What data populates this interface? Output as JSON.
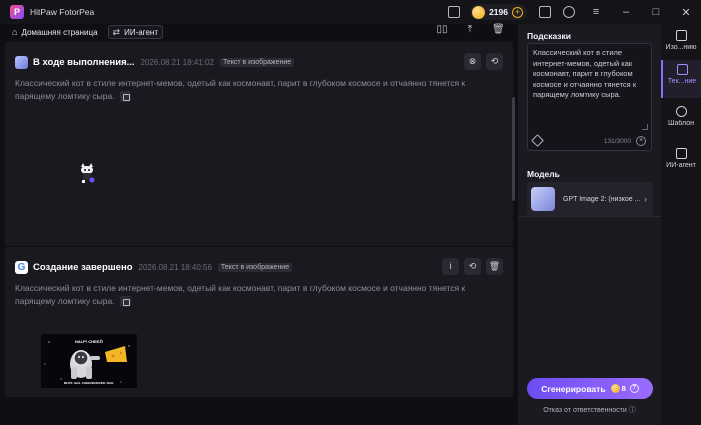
{
  "app": {
    "title": "HitPaw FotorPea"
  },
  "titlebar": {
    "credits": "2196"
  },
  "nav": {
    "home_label": "Домашняя страница",
    "agent_label": "ИИ-агент"
  },
  "tasks": [
    {
      "title": "В ходе выполнения...",
      "time": "2026.08.21  18:41:02",
      "tag": "Текст в изображение",
      "prompt": "Классический кот в стиле интернет-мемов, одетый как космонавт, парит в глубоком космосе и отчаянно тянется к парящему ломтику сыра.",
      "status": "in-progress"
    },
    {
      "title": "Создание завершено",
      "time": "2026.08.21  18:40:56",
      "tag": "Текст в изображение",
      "prompt": "Классический кот в стиле интернет-мемов, одетый как космонавт, парит в глубоком космосе и отчаянно тянется к парящему ломтику сыра.",
      "status": "done",
      "image_text": {
        "top": "HALP! CHEEZ!",
        "bottom": "MUST. HAS. CHEEZBURGER. NAO."
      }
    }
  ],
  "panel": {
    "hints_heading": "Подсказки",
    "prompt_text": "Классический кот в стиле интернет-мемов, одетый как космонавт, парит в глубоком космосе и отчаянно тянется к парящему ломтику сыра.",
    "char_count": "131/3000",
    "model_heading": "Модель",
    "model_name": "GPT Image 2: (низкое ...",
    "generate_label": "Сгенерировать",
    "generate_cost": "8",
    "disclaimer": "Отказ от ответственности"
  },
  "rail": [
    {
      "label": "Изо...нию",
      "icon": "image-icon"
    },
    {
      "label": "Тек...ние",
      "icon": "text-to-image-icon",
      "active": true
    },
    {
      "label": "Шаблон",
      "icon": "template-icon"
    },
    {
      "label": "ИИ-агент",
      "icon": "ai-agent-icon"
    }
  ],
  "colors": {
    "accent": "#8b6cff",
    "generate_start": "#6d4df2",
    "generate_end": "#9b6bff",
    "background": "#0f0e12",
    "card": "#1a1920"
  }
}
